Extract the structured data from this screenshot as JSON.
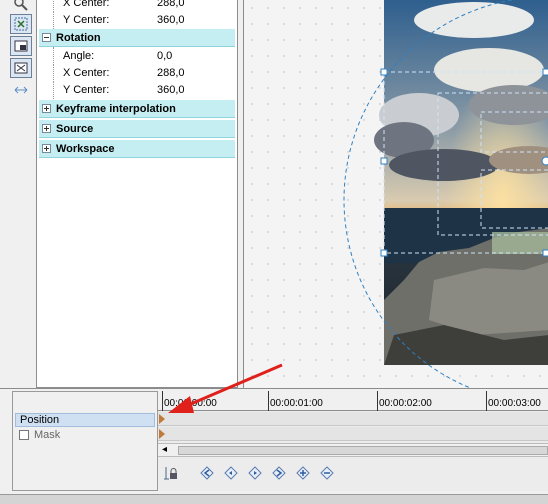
{
  "properties": {
    "rows": [
      {
        "label": "X Center:",
        "value": "288,0"
      },
      {
        "label": "Y Center:",
        "value": "360,0"
      }
    ],
    "rotation": {
      "title": "Rotation",
      "rows": [
        {
          "label": "Angle:",
          "value": "0,0"
        },
        {
          "label": "X Center:",
          "value": "288,0"
        },
        {
          "label": "Y Center:",
          "value": "360,0"
        }
      ]
    },
    "categories": [
      {
        "label": "Keyframe interpolation"
      },
      {
        "label": "Source"
      },
      {
        "label": "Workspace"
      }
    ]
  },
  "timeline": {
    "ruler": [
      "00:00:00:00",
      "00:00:01:00",
      "00:00:02:00",
      "00:00:03:00"
    ],
    "tracks": [
      {
        "label": "Position",
        "selected": true
      },
      {
        "label": "Mask",
        "checked": false
      }
    ],
    "toolbar_icons": [
      "lock-icon",
      "first-keyframe-icon",
      "prev-keyframe-icon",
      "next-keyframe-icon",
      "last-keyframe-icon",
      "add-keyframe-icon",
      "remove-keyframe-icon"
    ]
  },
  "colors": {
    "category_bg": "#c5eef3",
    "selection": "#cfe0f3",
    "handle": "#2f7fc1",
    "arrow": "#e0201b"
  }
}
